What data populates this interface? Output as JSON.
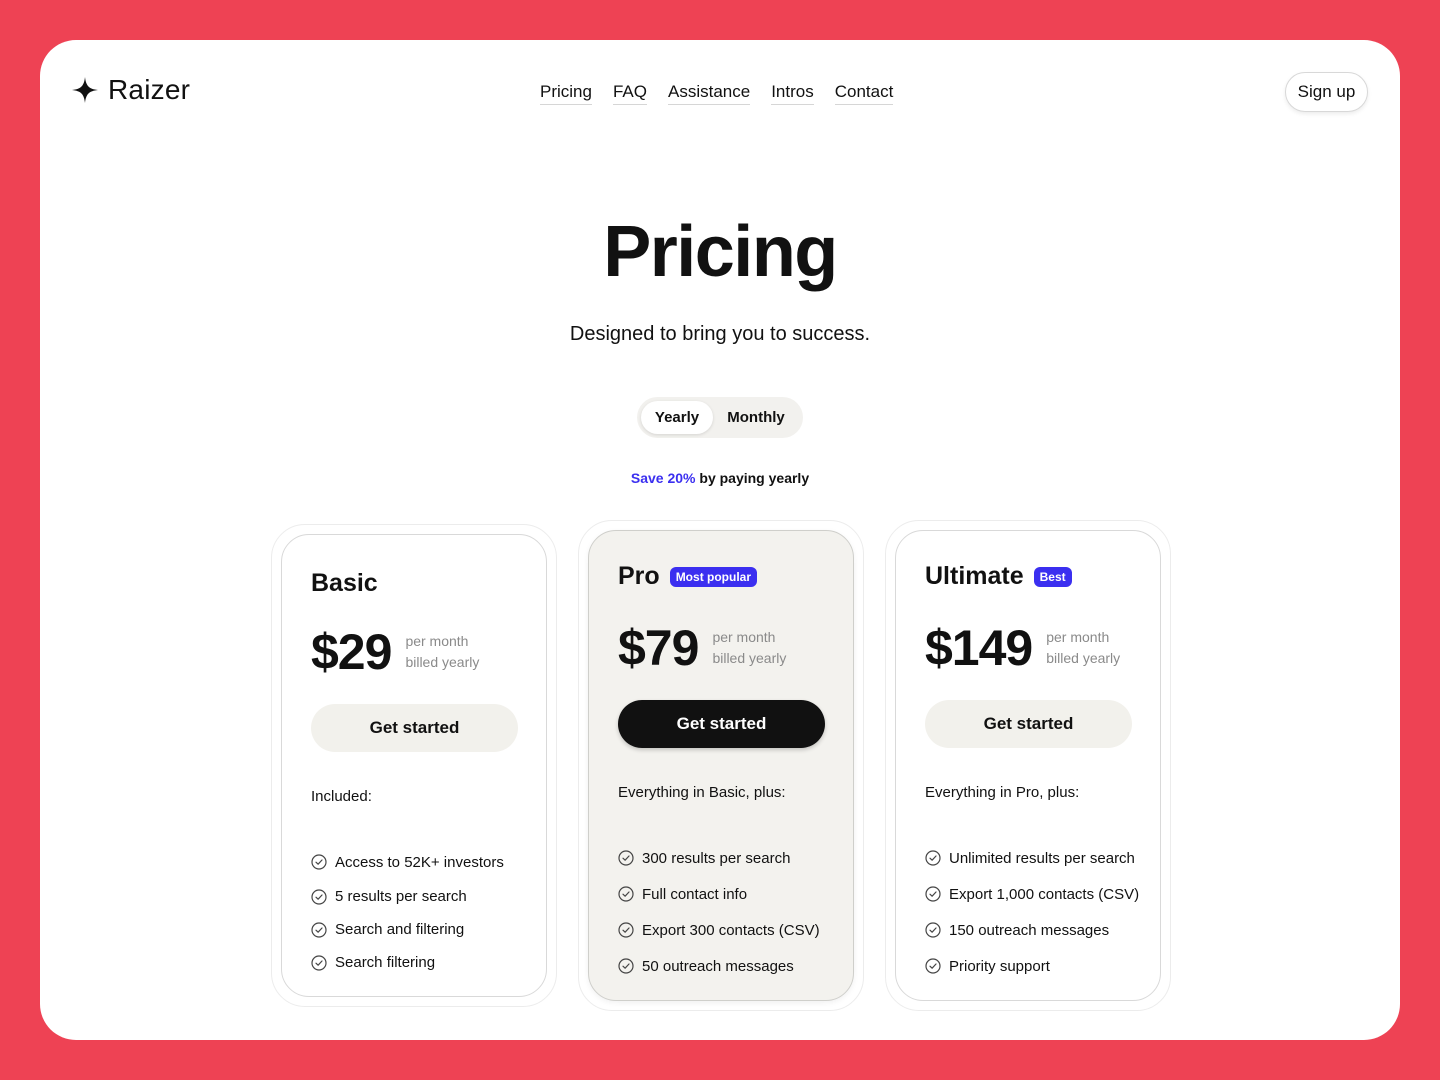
{
  "brand": {
    "name": "Raizer"
  },
  "nav": {
    "items": [
      {
        "id": "pricing",
        "label": "Pricing"
      },
      {
        "id": "faq",
        "label": "FAQ"
      },
      {
        "id": "assistance",
        "label": "Assistance"
      },
      {
        "id": "intros",
        "label": "Intros"
      },
      {
        "id": "contact",
        "label": "Contact"
      }
    ],
    "signup_label": "Sign up"
  },
  "hero": {
    "title": "Pricing",
    "subtitle": "Designed to bring you to success."
  },
  "billing_toggle": {
    "options": [
      "Yearly",
      "Monthly"
    ],
    "selected": "Yearly"
  },
  "save_note": {
    "highlight": "Save 20%",
    "rest": " by paying yearly"
  },
  "plans": [
    {
      "name": "Basic",
      "badge": "",
      "price": "$29",
      "price_line1": "per month",
      "price_line2": "billed yearly",
      "cta": "Get started",
      "included_label": "Included:",
      "features": [
        "Access to 52K+ investors",
        "5 results per search",
        "Search and filtering",
        "Search filtering"
      ]
    },
    {
      "name": "Pro",
      "badge": "Most popular",
      "price": "$79",
      "price_line1": "per month",
      "price_line2": "billed yearly",
      "cta": "Get started",
      "included_label": "Everything in Basic, plus:",
      "features": [
        "300 results per search",
        "Full contact info",
        "Export 300 contacts (CSV)",
        "50 outreach messages"
      ]
    },
    {
      "name": "Ultimate",
      "badge": "Best",
      "price": "$149",
      "price_line1": "per month",
      "price_line2": "billed yearly",
      "cta": "Get started",
      "included_label": "Everything in Pro, plus:",
      "features": [
        "Unlimited results per search",
        "Export 1,000 contacts (CSV)",
        "150 outreach messages",
        "Priority support"
      ]
    }
  ],
  "icons": {
    "logo": "four-point-star-icon",
    "feature_check": "check-circle-icon"
  },
  "colors": {
    "background": "#ee4254",
    "accent": "#3b2ff0",
    "featured_card": "#f3f2ee",
    "primary_button": "#111111"
  }
}
